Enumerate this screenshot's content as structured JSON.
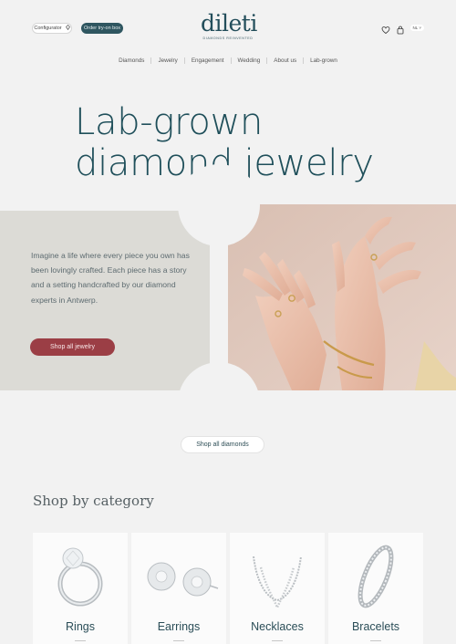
{
  "header": {
    "configurator_label": "Configurator",
    "tryon_label": "Order try-on box",
    "logo_word": "dileti",
    "logo_tagline": "DIAMONDS REINVENTED",
    "language": "NL ˅"
  },
  "nav": {
    "items": [
      {
        "label": "Diamonds"
      },
      {
        "label": "Jewelry"
      },
      {
        "label": "Engagement"
      },
      {
        "label": "Wedding"
      },
      {
        "label": "About us"
      },
      {
        "label": "Lab-grown"
      }
    ]
  },
  "hero": {
    "title_line1": "Lab-grown",
    "title_line2": "diamond jewelry",
    "body": " Imagine a life where every piece you own has been lovingly crafted. Each piece has a story and a setting handcrafted by our diamond experts in Antwerp.",
    "cta_label": "Shop all jewelry"
  },
  "diamonds_cta_label": "Shop all diamonds",
  "category_section": {
    "title": "Shop by category",
    "cards": [
      {
        "label": "Rings"
      },
      {
        "label": "Earrings"
      },
      {
        "label": "Necklaces"
      },
      {
        "label": "Bracelets"
      }
    ]
  },
  "colors": {
    "brand_teal": "#1f4f5a",
    "cta_red": "#9b3e45",
    "panel_grey": "#dcdbd6",
    "page_bg": "#f2f2f2"
  },
  "icons": [
    "diamond-icon",
    "heart-icon",
    "bag-icon"
  ]
}
